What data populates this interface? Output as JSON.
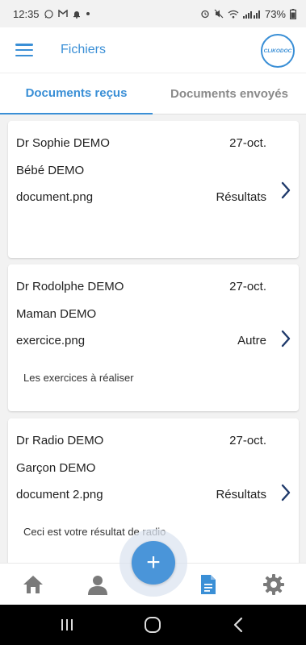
{
  "status_bar": {
    "time": "12:35",
    "left_icons": [
      "whatsapp-icon",
      "gmail-icon",
      "bell-icon",
      "dot-icon"
    ],
    "right_icons": [
      "alarm-icon",
      "mute-icon",
      "wifi-icon",
      "signal-icon"
    ],
    "battery": "73%"
  },
  "header": {
    "title": "Fichiers",
    "logo_text": "CLIKODOC"
  },
  "tabs": [
    {
      "label": "Documents reçus",
      "active": true
    },
    {
      "label": "Documents envoyés",
      "active": false
    }
  ],
  "documents": [
    {
      "doctor": "Dr Sophie DEMO",
      "date": "27-oct.",
      "patient": "Bébé DEMO",
      "file": "document.png",
      "category": "Résultats",
      "comment": ""
    },
    {
      "doctor": "Dr Rodolphe DEMO",
      "date": "27-oct.",
      "patient": "Maman DEMO",
      "file": "exercice.png",
      "category": "Autre",
      "comment": "Les exercices à réaliser"
    },
    {
      "doctor": "Dr Radio DEMO",
      "date": "27-oct.",
      "patient": "Garçon DEMO",
      "file": "document 2.png",
      "category": "Résultats",
      "comment": "Ceci est votre résultat de radio"
    }
  ],
  "bottom_nav": {
    "items": [
      "home-icon",
      "profile-icon",
      "documents-icon",
      "settings-icon"
    ],
    "active": "documents-icon",
    "fab_label": "+"
  },
  "colors": {
    "accent": "#3a8fd6",
    "fab": "#4a95d9",
    "inactive_tab": "#8a8a8a",
    "nav_icon": "#7a7a7a",
    "chevron": "#1f3a6b"
  }
}
